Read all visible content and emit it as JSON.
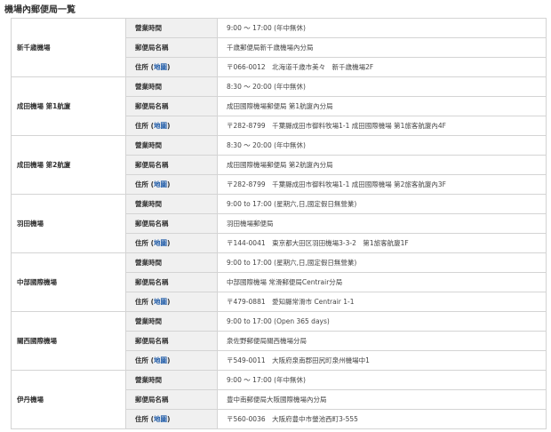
{
  "title": "機場內郵便局一覧",
  "labels": {
    "hours": "營業時間",
    "office": "郵便局名稱",
    "address_prefix": "住所 (",
    "map": "地圖",
    "address_suffix": ")"
  },
  "airports": [
    {
      "name": "新千歳機場",
      "hours": "9:00 ～ 17:00 (年中無休)",
      "office": "千歳郵便局新千歳機場內分局",
      "address": "〒066-0012　北海道千歳市美々　新千歳機場2F"
    },
    {
      "name": "成田機場 第1航廈",
      "hours": "8:30 ～ 20:00 (年中無休)",
      "office": "成田國際機場郵便局 第1航廈內分局",
      "address": "〒282-8799　千葉縣成田市御料牧場1-1 成田國際機場 第1旅客航廈內4F"
    },
    {
      "name": "成田機場 第2航廈",
      "hours": "8:30 ～ 20:00 (年中無休)",
      "office": "成田國際機場郵便局 第2航廈內分局",
      "address": "〒282-8799　千葉縣成田市御料牧場1-1 成田國際機場 第2旅客航廈內3F"
    },
    {
      "name": "羽田機場",
      "hours": "9:00 to 17:00 (星期六,日,國定假日無營業)",
      "office": "羽田機場郵便局",
      "address": "〒144-0041　東京都大田区羽田機場3-3-2　第1旅客航廈1F"
    },
    {
      "name": "中部國際機場",
      "hours": "9:00 to 17:00 (星期六,日,國定假日無營業)",
      "office": "中部國際機場 常滑郵便局Centrair分局",
      "address": "〒479-0881　愛知縣常滑市 Centrair 1-1"
    },
    {
      "name": "關西國際機場",
      "hours": "9:00 to 17:00 (Open 365 days)",
      "office": "泉佐野郵便局關西機場分局",
      "address": "〒549-0011　大阪府泉南郡田尻町泉州機場中1"
    },
    {
      "name": "伊丹機場",
      "hours": "9:00 ～ 17:00 (年中無休)",
      "office": "豊中南郵便局大阪國際機場內分局",
      "address": "〒560-0036　大阪府豊中市螢池西町3-555"
    }
  ]
}
